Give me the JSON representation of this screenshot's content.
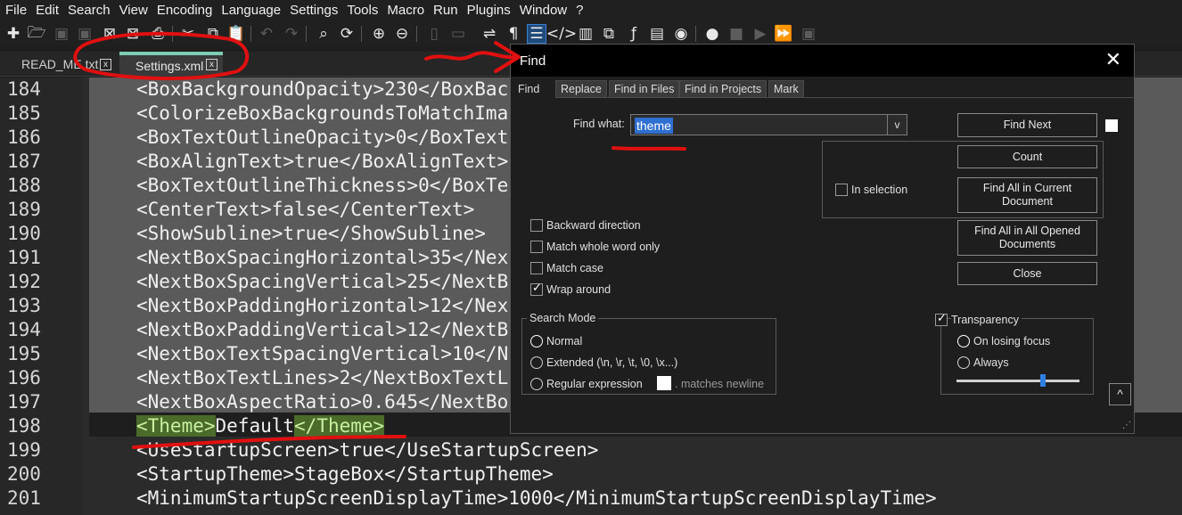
{
  "menu": [
    "File",
    "Edit",
    "Search",
    "View",
    "Encoding",
    "Language",
    "Settings",
    "Tools",
    "Macro",
    "Run",
    "Plugins",
    "Window",
    "?"
  ],
  "tabs": [
    {
      "label": "READ_ME.txt",
      "close": "x"
    },
    {
      "label": "Settings.xml",
      "close": "x"
    }
  ],
  "editor": {
    "lines": [
      {
        "n": "184",
        "text": "<BoxBackgroundOpacity>230</BoxBac"
      },
      {
        "n": "185",
        "text": "<ColorizeBoxBackgroundsToMatchIma"
      },
      {
        "n": "186",
        "text": "<BoxTextOutlineOpacity>0</BoxText"
      },
      {
        "n": "187",
        "text": "<BoxAlignText>true</BoxAlignText>"
      },
      {
        "n": "188",
        "text": "<BoxTextOutlineThickness>0</BoxTe"
      },
      {
        "n": "189",
        "text": "<CenterText>false</CenterText>"
      },
      {
        "n": "190",
        "text": "<ShowSubline>true</ShowSubline>"
      },
      {
        "n": "191",
        "text": "<NextBoxSpacingHorizontal>35</Nex"
      },
      {
        "n": "192",
        "text": "<NextBoxSpacingVertical>25</NextB"
      },
      {
        "n": "193",
        "text": "<NextBoxPaddingHorizontal>12</Nex"
      },
      {
        "n": "194",
        "text": "<NextBoxPaddingVertical>12</NextB"
      },
      {
        "n": "195",
        "text": "<NextBoxTextSpacingVertical>10</N"
      },
      {
        "n": "196",
        "text": "<NextBoxTextLines>2</NextBoxTextL"
      },
      {
        "n": "197",
        "text": "<NextBoxAspectRatio>0.645</NextBo"
      },
      {
        "n": "198",
        "hl_open": "<Theme>",
        "mid": "Default",
        "hl_close": "</Theme>"
      },
      {
        "n": "199",
        "text": "<UseStartupScreen>true</UseStartupScreen>"
      },
      {
        "n": "200",
        "text": "<StartupTheme>StageBox</StartupTheme>"
      },
      {
        "n": "201",
        "text": "<MinimumStartupScreenDisplayTime>1000</MinimumStartupScreenDisplayTime>"
      }
    ]
  },
  "find_dialog": {
    "title": "Find",
    "close": "✕",
    "tabs": [
      "Find",
      "Replace",
      "Find in Files",
      "Find in Projects",
      "Mark"
    ],
    "find_what_label": "Find what:",
    "find_what_value": "theme",
    "dropdown": "v",
    "buttons": {
      "find_next": "Find Next",
      "count": "Count",
      "find_all_current": "Find All in Current Document",
      "find_all_opened": "Find All in All Opened Documents",
      "close": "Close",
      "collapse": "^"
    },
    "in_selection": "In selection",
    "options": [
      {
        "label": "Backward direction",
        "checked": false
      },
      {
        "label": "Match whole word only",
        "checked": false
      },
      {
        "label": "Match case",
        "checked": false
      },
      {
        "label": "Wrap around",
        "checked": true
      }
    ],
    "search_mode": {
      "title": "Search Mode",
      "normal": "Normal",
      "extended": "Extended (\\n, \\r, \\t, \\0, \\x...)",
      "regex": "Regular expression",
      "matches_newline": ". matches newline",
      "selected": "normal"
    },
    "transparency": {
      "label": "Transparency",
      "checked": true,
      "on_losing_focus": "On losing focus",
      "always": "Always",
      "level": 0.68
    }
  },
  "colors": {
    "accent_tab": "#7ccdb4",
    "highlight": "#4a6b2a",
    "annotation": "#e01010",
    "selection": "#2f6fd0"
  }
}
